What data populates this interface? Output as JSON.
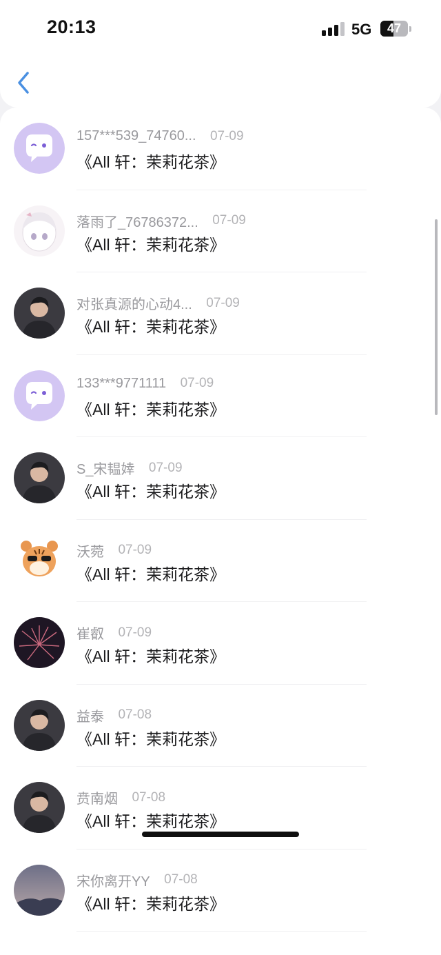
{
  "status_bar": {
    "time": "20:13",
    "network": "5G",
    "battery": "47",
    "battery_level": 0.47
  },
  "nav": {
    "back_icon": "chevron-left-icon",
    "accent_color": "#4a90e2"
  },
  "list": [
    {
      "name": "157***539_74760...",
      "date": "07-09",
      "text": "《All 轩：茉莉花茶》",
      "avatar": "default-chat-avatar"
    },
    {
      "name": "落雨了_76786372...",
      "date": "07-09",
      "text": "《All 轩：茉莉花茶》",
      "avatar": "anime-girl-avatar"
    },
    {
      "name": "对张真源的心动4...",
      "date": "07-09",
      "text": "《All 轩：茉莉花茶》",
      "avatar": "photo-avatar"
    },
    {
      "name": "133***9771111",
      "date": "07-09",
      "text": "《All 轩：茉莉花茶》",
      "avatar": "default-chat-avatar"
    },
    {
      "name": "S_宋韫婞",
      "date": "07-09",
      "text": "《All 轩：茉莉花茶》",
      "avatar": "photo-avatar"
    },
    {
      "name": "沃菀",
      "date": "07-09",
      "text": "《All 轩：茉莉花茶》",
      "avatar": "tiger-cartoon-avatar"
    },
    {
      "name": "崔叡",
      "date": "07-09",
      "text": "《All 轩：茉莉花茶》",
      "avatar": "fireworks-avatar"
    },
    {
      "name": "益泰",
      "date": "07-08",
      "text": "《All 轩：茉莉花茶》",
      "avatar": "photo-avatar"
    },
    {
      "name": "贲南烟",
      "date": "07-08",
      "text": "《All 轩：茉莉花茶》",
      "avatar": "photo-avatar"
    },
    {
      "name": "宋你离开YY",
      "date": "07-08",
      "text": "《All 轩：茉莉花茶》",
      "avatar": "landscape-avatar"
    }
  ],
  "colors": {
    "default_avatar_bg": "#d3c6f3",
    "default_avatar_accent": "#7c5fd6"
  }
}
